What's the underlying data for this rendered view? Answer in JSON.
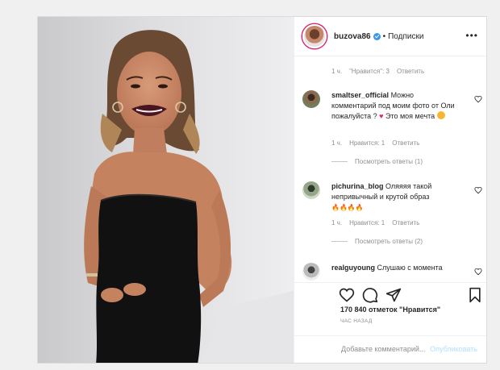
{
  "header": {
    "username": "buzova86",
    "separator": "•",
    "follow_label": "Подписки",
    "more_label": "•••"
  },
  "first_comment_meta": {
    "time": "1 ч.",
    "likes": "\"Нравится\": 3",
    "reply": "Ответить"
  },
  "comments": [
    {
      "username": "smaltser_official",
      "text": "Можно комментарий под моим фото от Оли пожалуйста ?",
      "text_tail": " Это моя мечта",
      "time": "1 ч.",
      "likes": "Нравится: 1",
      "reply": "Ответить",
      "view_replies": "Посмотреть ответы (1)"
    },
    {
      "username": "pichurina_blog",
      "text": "Оляяяя такой непривычный и крутой образ",
      "emoji": "🔥🔥🔥🔥",
      "time": "1 ч.",
      "likes": "Нравится: 1",
      "reply": "Ответить",
      "view_replies": "Посмотреть ответы (2)"
    },
    {
      "username": "realguyoung",
      "text": "Слушаю с момента"
    }
  ],
  "post": {
    "likes_label": "170 840 отметок \"Нравится\"",
    "time_label": "ЧАС НАЗАД"
  },
  "comment_box": {
    "placeholder": "Добавьте комментарий...",
    "publish_label": "Опубликовать"
  },
  "colors": {
    "verified": "#3897f0",
    "publish_disabled": "#b2dffc",
    "muted_text": "#8e8e8e"
  }
}
